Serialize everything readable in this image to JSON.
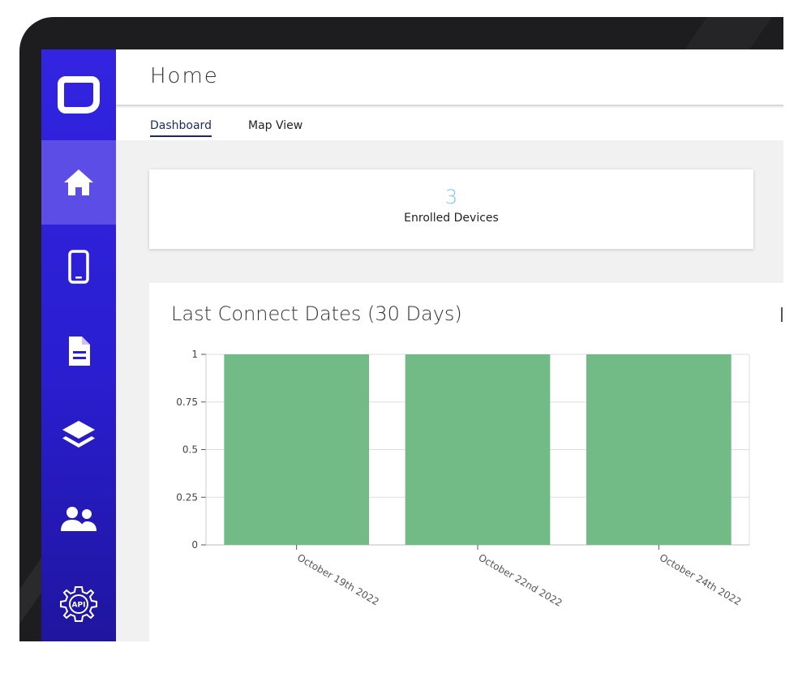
{
  "header": {
    "title": "Home"
  },
  "tabs": [
    {
      "label": "Dashboard",
      "active": true
    },
    {
      "label": "Map View",
      "active": false
    }
  ],
  "sidebar": {
    "brand_color": "#3224e0",
    "active_color": "#5b4de6",
    "items": [
      {
        "icon": "home-icon",
        "active": true
      },
      {
        "icon": "phone-icon",
        "active": false
      },
      {
        "icon": "document-icon",
        "active": false
      },
      {
        "icon": "layers-icon",
        "active": false
      },
      {
        "icon": "users-icon",
        "active": false
      },
      {
        "icon": "api-gear-icon",
        "active": false,
        "label": "API"
      }
    ]
  },
  "stat": {
    "value": "3",
    "label": "Enrolled Devices"
  },
  "chart": {
    "title": "Last Connect Dates (30 Days)"
  },
  "chart_data": {
    "type": "bar",
    "title": "Last Connect Dates (30 Days)",
    "xlabel": "",
    "ylabel": "",
    "categories": [
      "October 19th 2022",
      "October 22nd 2022",
      "October 24th 2022"
    ],
    "values": [
      1,
      1,
      1
    ],
    "ylim": [
      0,
      1
    ],
    "yticks": [
      "0",
      "0.25",
      "0.5",
      "0.75",
      "1"
    ],
    "grid": true,
    "bar_color": "#72bb87"
  }
}
